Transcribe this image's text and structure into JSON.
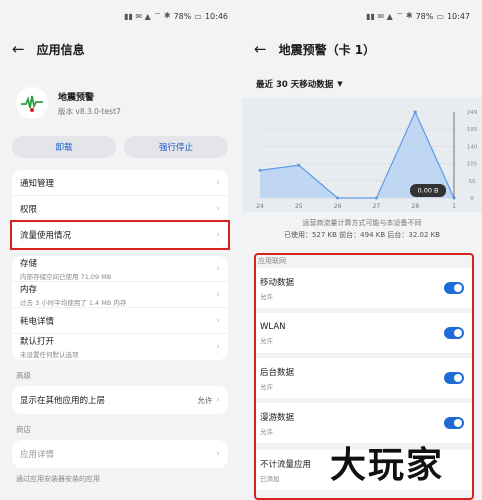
{
  "left": {
    "status": {
      "battery": "78%",
      "time": "10:46"
    },
    "header": {
      "title": "应用信息"
    },
    "app": {
      "name": "地震预警",
      "version": "版本 v8.3.0-test7"
    },
    "buttons": {
      "uninstall": "卸载",
      "force_stop": "强行停止"
    },
    "group1": [
      "通知管理",
      "权限",
      "流量使用情况"
    ],
    "storage": {
      "label": "存储",
      "sub": "内部存储空间已使用 71.09 MB"
    },
    "memory": {
      "label": "内存",
      "sub": "过去 3 小时平均使用了 1.4 MB 内存"
    },
    "battery_detail": "耗电详情",
    "default_open": {
      "label": "默认打开",
      "sub": "未设置任何默认选项"
    },
    "advanced_label": "高级",
    "overlay": {
      "label": "显示在其他应用的上层",
      "value": "允许"
    },
    "store_label": "商店",
    "app_detail": "应用详情",
    "footer": "通过应用安装器安装的应用"
  },
  "right": {
    "status": {
      "battery": "78%",
      "time": "10:47"
    },
    "header": {
      "title": "地震预警（卡 1）"
    },
    "filter": "最近 30 天移动数据",
    "tooltip": "0.00 B",
    "note": "运营商流量计算方式可能与本设备不同",
    "usage": "已使用：527 KB 前台：494 KB 后台：32.02 KB",
    "net_label": "应用联网",
    "toggles": [
      {
        "label": "移动数据",
        "sub": "允许"
      },
      {
        "label": "WLAN",
        "sub": "允许"
      },
      {
        "label": "后台数据",
        "sub": "允许"
      },
      {
        "label": "漫游数据",
        "sub": "允许"
      }
    ],
    "unmetered": {
      "label": "不计流量应用",
      "sub": "已添加"
    }
  },
  "chart_data": {
    "type": "area",
    "x": [
      "24",
      "25",
      "26",
      "27",
      "28",
      "1"
    ],
    "y_ticks": [
      "249",
      "195",
      "140",
      "105",
      "50",
      "0"
    ],
    "values": [
      80,
      95,
      0,
      0,
      249,
      0
    ]
  },
  "watermark": "大玩家"
}
